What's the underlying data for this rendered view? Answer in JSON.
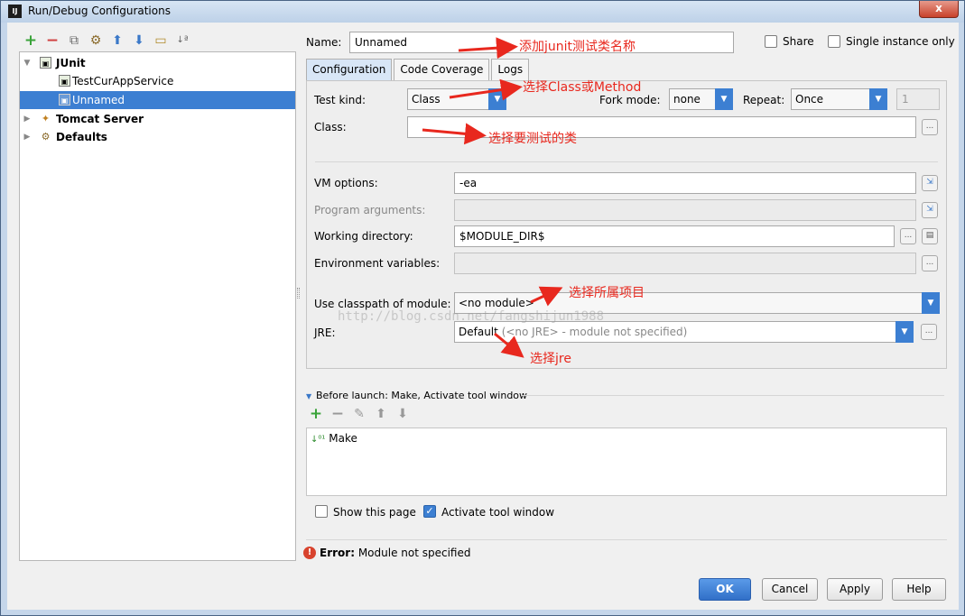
{
  "window": {
    "title": "Run/Debug Configurations",
    "close_glyph": "x"
  },
  "toolbar": {
    "icons": [
      "add-icon",
      "remove-icon",
      "copy-icon",
      "wrench-icon",
      "move-up-icon",
      "move-down-icon",
      "folder-icon",
      "sort-icon"
    ]
  },
  "tree": {
    "items": [
      {
        "label": "JUnit",
        "expanded": true
      },
      {
        "label": "TestCurAppService"
      },
      {
        "label": "Unnamed",
        "selected": true
      },
      {
        "label": "Tomcat Server",
        "expanded": false
      },
      {
        "label": "Defaults",
        "expanded": false
      }
    ]
  },
  "header": {
    "name_label": "Name:",
    "name_value": "Unnamed",
    "share_label": "Share",
    "single_instance_label": "Single instance only"
  },
  "tabs": [
    "Configuration",
    "Code Coverage",
    "Logs"
  ],
  "config": {
    "test_kind_label": "Test kind:",
    "test_kind_value": "Class",
    "fork_mode_label": "Fork mode:",
    "fork_mode_value": "none",
    "repeat_label": "Repeat:",
    "repeat_value": "Once",
    "repeat_count": "1",
    "class_label": "Class:",
    "class_value": "",
    "vm_options_label": "VM options:",
    "vm_options_value": "-ea",
    "program_args_label": "Program arguments:",
    "working_dir_label": "Working directory:",
    "working_dir_value": "$MODULE_DIR$",
    "env_vars_label": "Environment variables:",
    "classpath_label": "Use classpath of module:",
    "classpath_value": "<no module>",
    "jre_label": "JRE:",
    "jre_value": "Default",
    "jre_hint": "(<no JRE> - module not specified)",
    "ellipsis": "..."
  },
  "annotations": {
    "name": "添加junit测试类名称",
    "test_kind": "选择Class或Method",
    "class": "选择要测试的类",
    "module": "选择所属项目",
    "jre": "选择jre"
  },
  "watermark": "http://blog.csdn.net/fangshijun1988",
  "before_launch": {
    "title": "Before launch: Make, Activate tool window",
    "items": [
      "Make"
    ]
  },
  "options": {
    "show_page_label": "Show this page",
    "show_page_checked": false,
    "activate_tool_label": "Activate tool window",
    "activate_tool_checked": true
  },
  "error": {
    "prefix": "Error:",
    "message": "Module not specified"
  },
  "buttons": {
    "ok": "OK",
    "cancel": "Cancel",
    "apply": "Apply",
    "help": "Help"
  },
  "colors": {
    "selection": "#3c7fd2",
    "annotation": "#e8281e",
    "error": "#d8432e"
  }
}
